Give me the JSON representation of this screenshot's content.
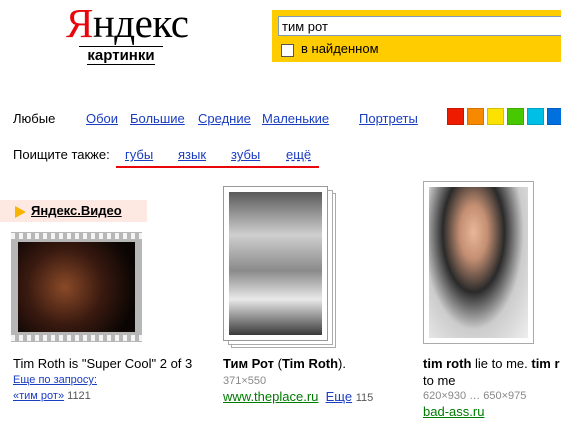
{
  "logo": {
    "main_first": "Я",
    "main_rest": "ндекс",
    "sub": "картинки"
  },
  "search": {
    "value": "тим рот",
    "found_label": "в найденном"
  },
  "filters": {
    "any": "Любые",
    "items": [
      "Обои",
      "Большие",
      "Средние",
      "Маленькие"
    ],
    "portraits": "Портреты",
    "colors": [
      "#ee1b00",
      "#f68900",
      "#fbe200",
      "#48c800",
      "#1fc000",
      "#00bfe6",
      "#0070df"
    ]
  },
  "also": {
    "label": "Поищите также:",
    "items": [
      "губы",
      "язык",
      "зубы",
      "ещё"
    ]
  },
  "video": {
    "title": "Яндекс.Видео",
    "caption": "Tim Roth is \"Super Cool\" 2 of 3",
    "more": "Еще по запросу:",
    "query": "«тим рот»",
    "count": "1121"
  },
  "result2": {
    "title_bold": "Тим Рот",
    "title_rest_bold": "Tim Roth",
    "size": "371×550",
    "site": "www.theplace.ru",
    "more": "Еще",
    "more_count": "115"
  },
  "result3": {
    "title_bold": "tim roth",
    "title_rest": " lie to me. ",
    "title_bold2": "tim r",
    "line2": "to me",
    "sizes": "620×930 … 650×975",
    "site": "bad-ass.ru"
  }
}
